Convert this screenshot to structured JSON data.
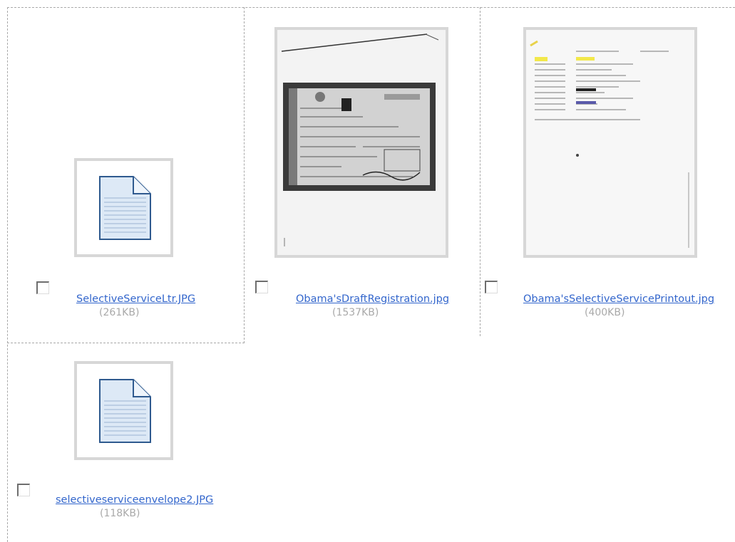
{
  "files": [
    {
      "name": "SelectiveServiceLtr.JPG",
      "size": "(261KB)",
      "thumbnail": "document-icon"
    },
    {
      "name": "Obama'sDraftRegistration.jpg",
      "size": "(1537KB)",
      "thumbnail": "scanned-draft-registration-card"
    },
    {
      "name": "Obama'sSelectiveServicePrintout.jpg",
      "size": "(400KB)",
      "thumbnail": "scanned-printout-page"
    },
    {
      "name": "selectiveserviceenvelope2.JPG",
      "size": "(118KB)",
      "thumbnail": "document-icon"
    }
  ],
  "colors": {
    "link": "#3366cc",
    "size_text": "#a9a9a9",
    "frame": "#d7d7d7",
    "grid_border": "#a8a8a8"
  }
}
